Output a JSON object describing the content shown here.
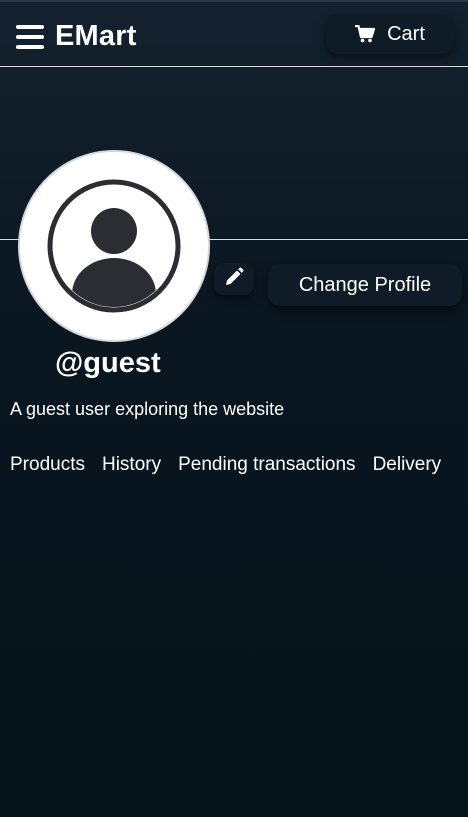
{
  "header": {
    "brand": "EMart",
    "cart_label": "Cart",
    "menu_icon": "hamburger-menu-icon",
    "cart_icon": "shopping-cart-icon"
  },
  "profile": {
    "avatar_icon": "user-avatar-icon",
    "edit_icon": "pencil-icon",
    "change_profile_label": "Change Profile",
    "username": "@guest",
    "bio": "A guest user exploring the website"
  },
  "tabs": [
    {
      "label": "Products"
    },
    {
      "label": "History"
    },
    {
      "label": "Pending transactions"
    },
    {
      "label": "Delivery"
    }
  ],
  "colors": {
    "background_top": "#14222f",
    "background_bottom": "#061219",
    "button_bg": "#0f1c27",
    "text": "#ffffff"
  }
}
